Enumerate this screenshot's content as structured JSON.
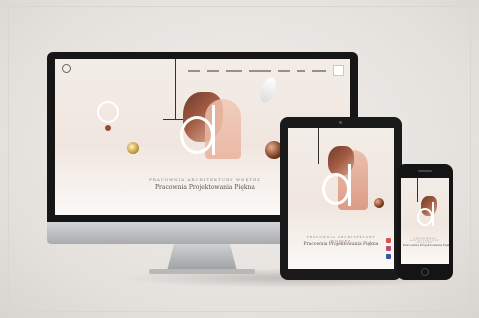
{
  "desktop": {
    "tagline": "PRACOWNIA ARCHITEKTURY WNĘTRZ",
    "title": "Pracownia Projektowania Piękna",
    "nav_items": [
      "",
      "",
      "",
      "",
      "",
      "",
      "",
      ""
    ]
  },
  "tablet": {
    "tagline": "PRACOWNIA ARCHITEKTURY WNĘTRZ",
    "title": "Pracownia Projektowania Piękna"
  },
  "phone": {
    "tagline": "PRACOWNIA ARCHITEKTURY WNĘTRZ",
    "title": "Pracownia Projektowania Piękna"
  },
  "colors": {
    "background": "#e9e7e4",
    "accent_copper": "#b8705a",
    "text": "#5a4d46",
    "social_youtube": "#d9534f",
    "social_instagram": "#c2497a",
    "social_facebook": "#3b5998"
  }
}
